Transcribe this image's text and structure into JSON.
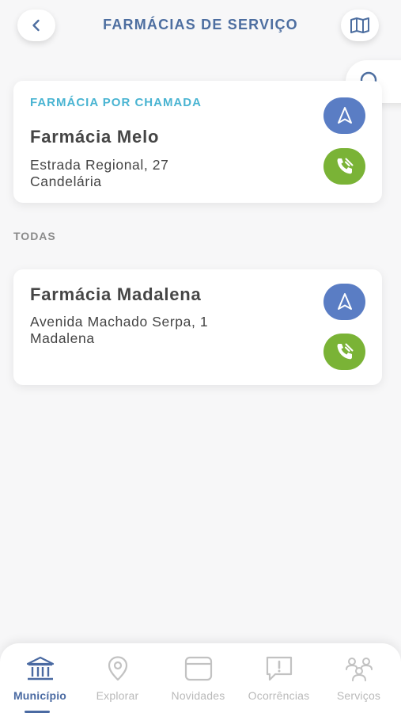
{
  "header": {
    "title": "FARMÁCIAS DE SERVIÇO",
    "back_icon": "chevron-left-icon",
    "map_icon": "map-icon",
    "search_icon": "search-icon"
  },
  "on_call": {
    "tag": "FARMÁCIA POR CHAMADA",
    "name": "Farmácia Melo",
    "address_line1": "Estrada Regional, 27",
    "address_line2": "Candelária"
  },
  "section_all": "TODAS",
  "pharmacies": [
    {
      "name": "Farmácia Madalena",
      "address_line1": "Avenida Machado Serpa, 1",
      "address_line2": "Madalena"
    }
  ],
  "colors": {
    "accent": "#4d6ea0",
    "tag": "#49b4d2",
    "navigate": "#5a7dc4",
    "call": "#7ab336"
  },
  "tabbar": {
    "items": [
      {
        "label": "Município",
        "icon": "institution-icon",
        "active": true
      },
      {
        "label": "Explorar",
        "icon": "location-pin-icon",
        "active": false
      },
      {
        "label": "Novidades",
        "icon": "news-card-icon",
        "active": false
      },
      {
        "label": "Ocorrências",
        "icon": "alert-message-icon",
        "active": false
      },
      {
        "label": "Serviços",
        "icon": "services-people-icon",
        "active": false
      }
    ]
  }
}
